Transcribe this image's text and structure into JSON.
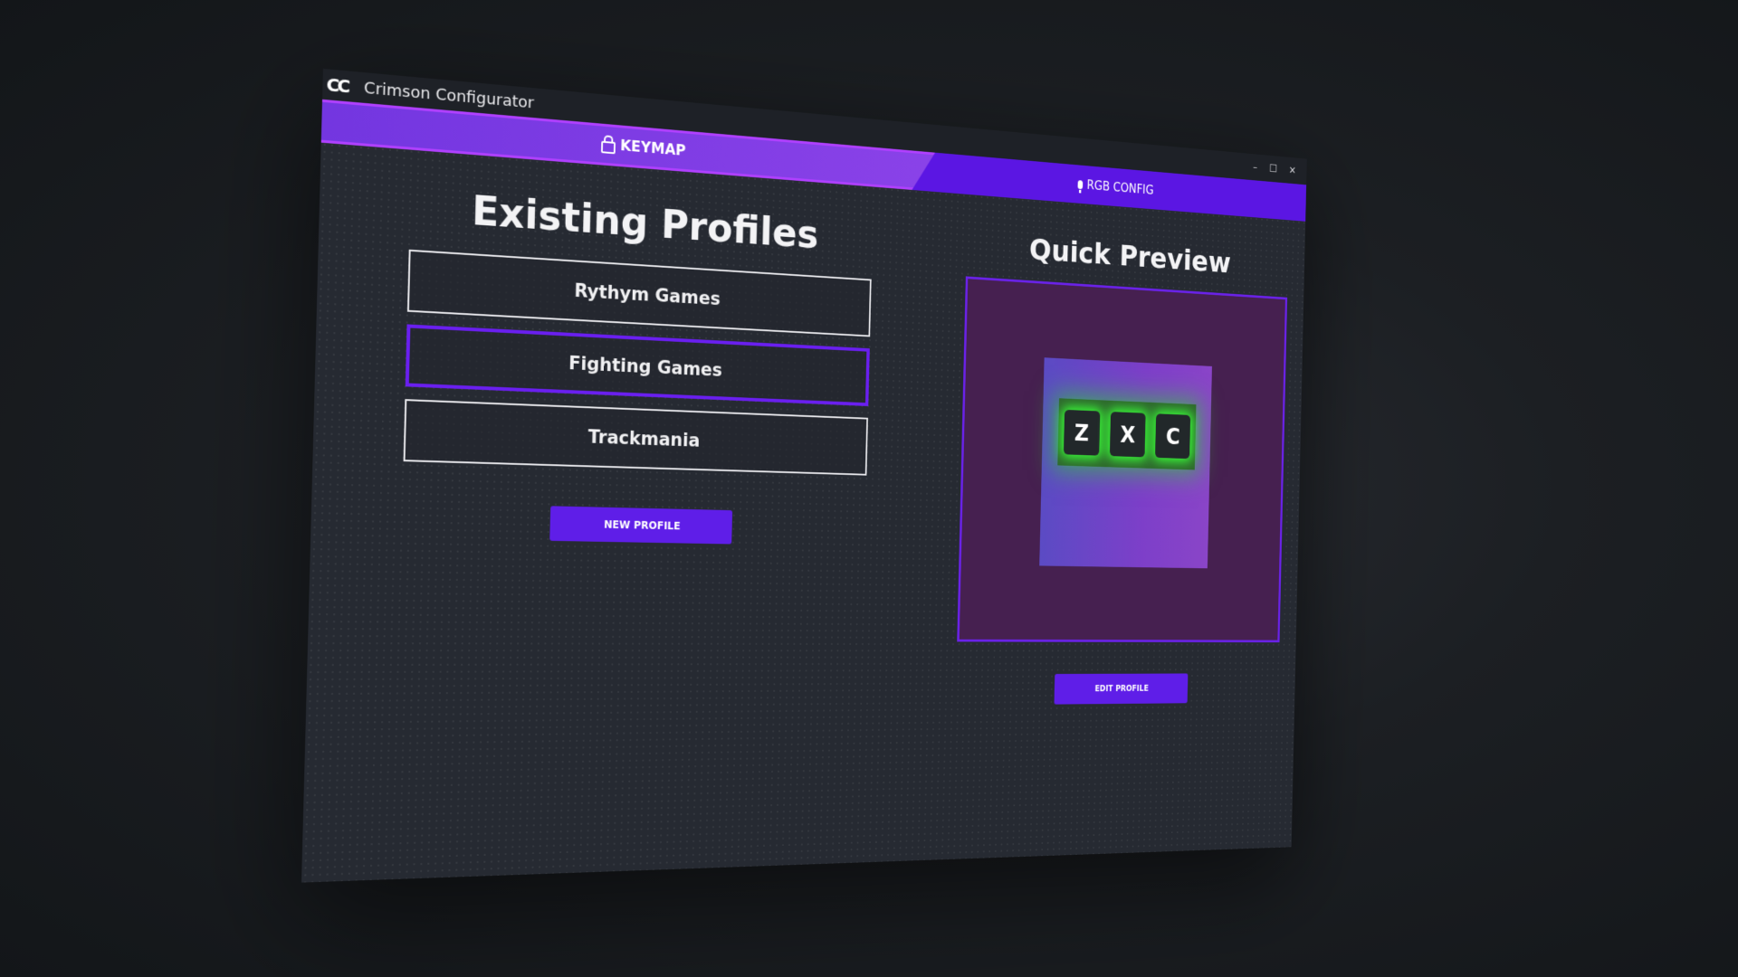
{
  "app": {
    "logo": "CC",
    "title": "Crimson Configurator",
    "window_controls": [
      "–",
      "☐",
      "✕"
    ]
  },
  "tabs": {
    "keymap": {
      "label": "KEYMAP",
      "icon": "lock-icon",
      "active": true
    },
    "rgb": {
      "label": "RGB CONFIG",
      "icon": "mic-icon",
      "active": false
    }
  },
  "profiles": {
    "heading": "Existing Profiles",
    "items": [
      {
        "label": "Rythym Games",
        "selected": false
      },
      {
        "label": "Fighting Games",
        "selected": true
      },
      {
        "label": "Trackmania",
        "selected": false
      }
    ],
    "new_button": "NEW PROFILE"
  },
  "preview": {
    "heading": "Quick Preview",
    "keys": [
      "Z",
      "X",
      "C"
    ],
    "edit_button": "EDIT PROFILE"
  },
  "colors": {
    "accent": "#5f1ee8",
    "window_bg": "#262a32",
    "preview_bg": "#462050",
    "key_glow": "#39ff38"
  }
}
